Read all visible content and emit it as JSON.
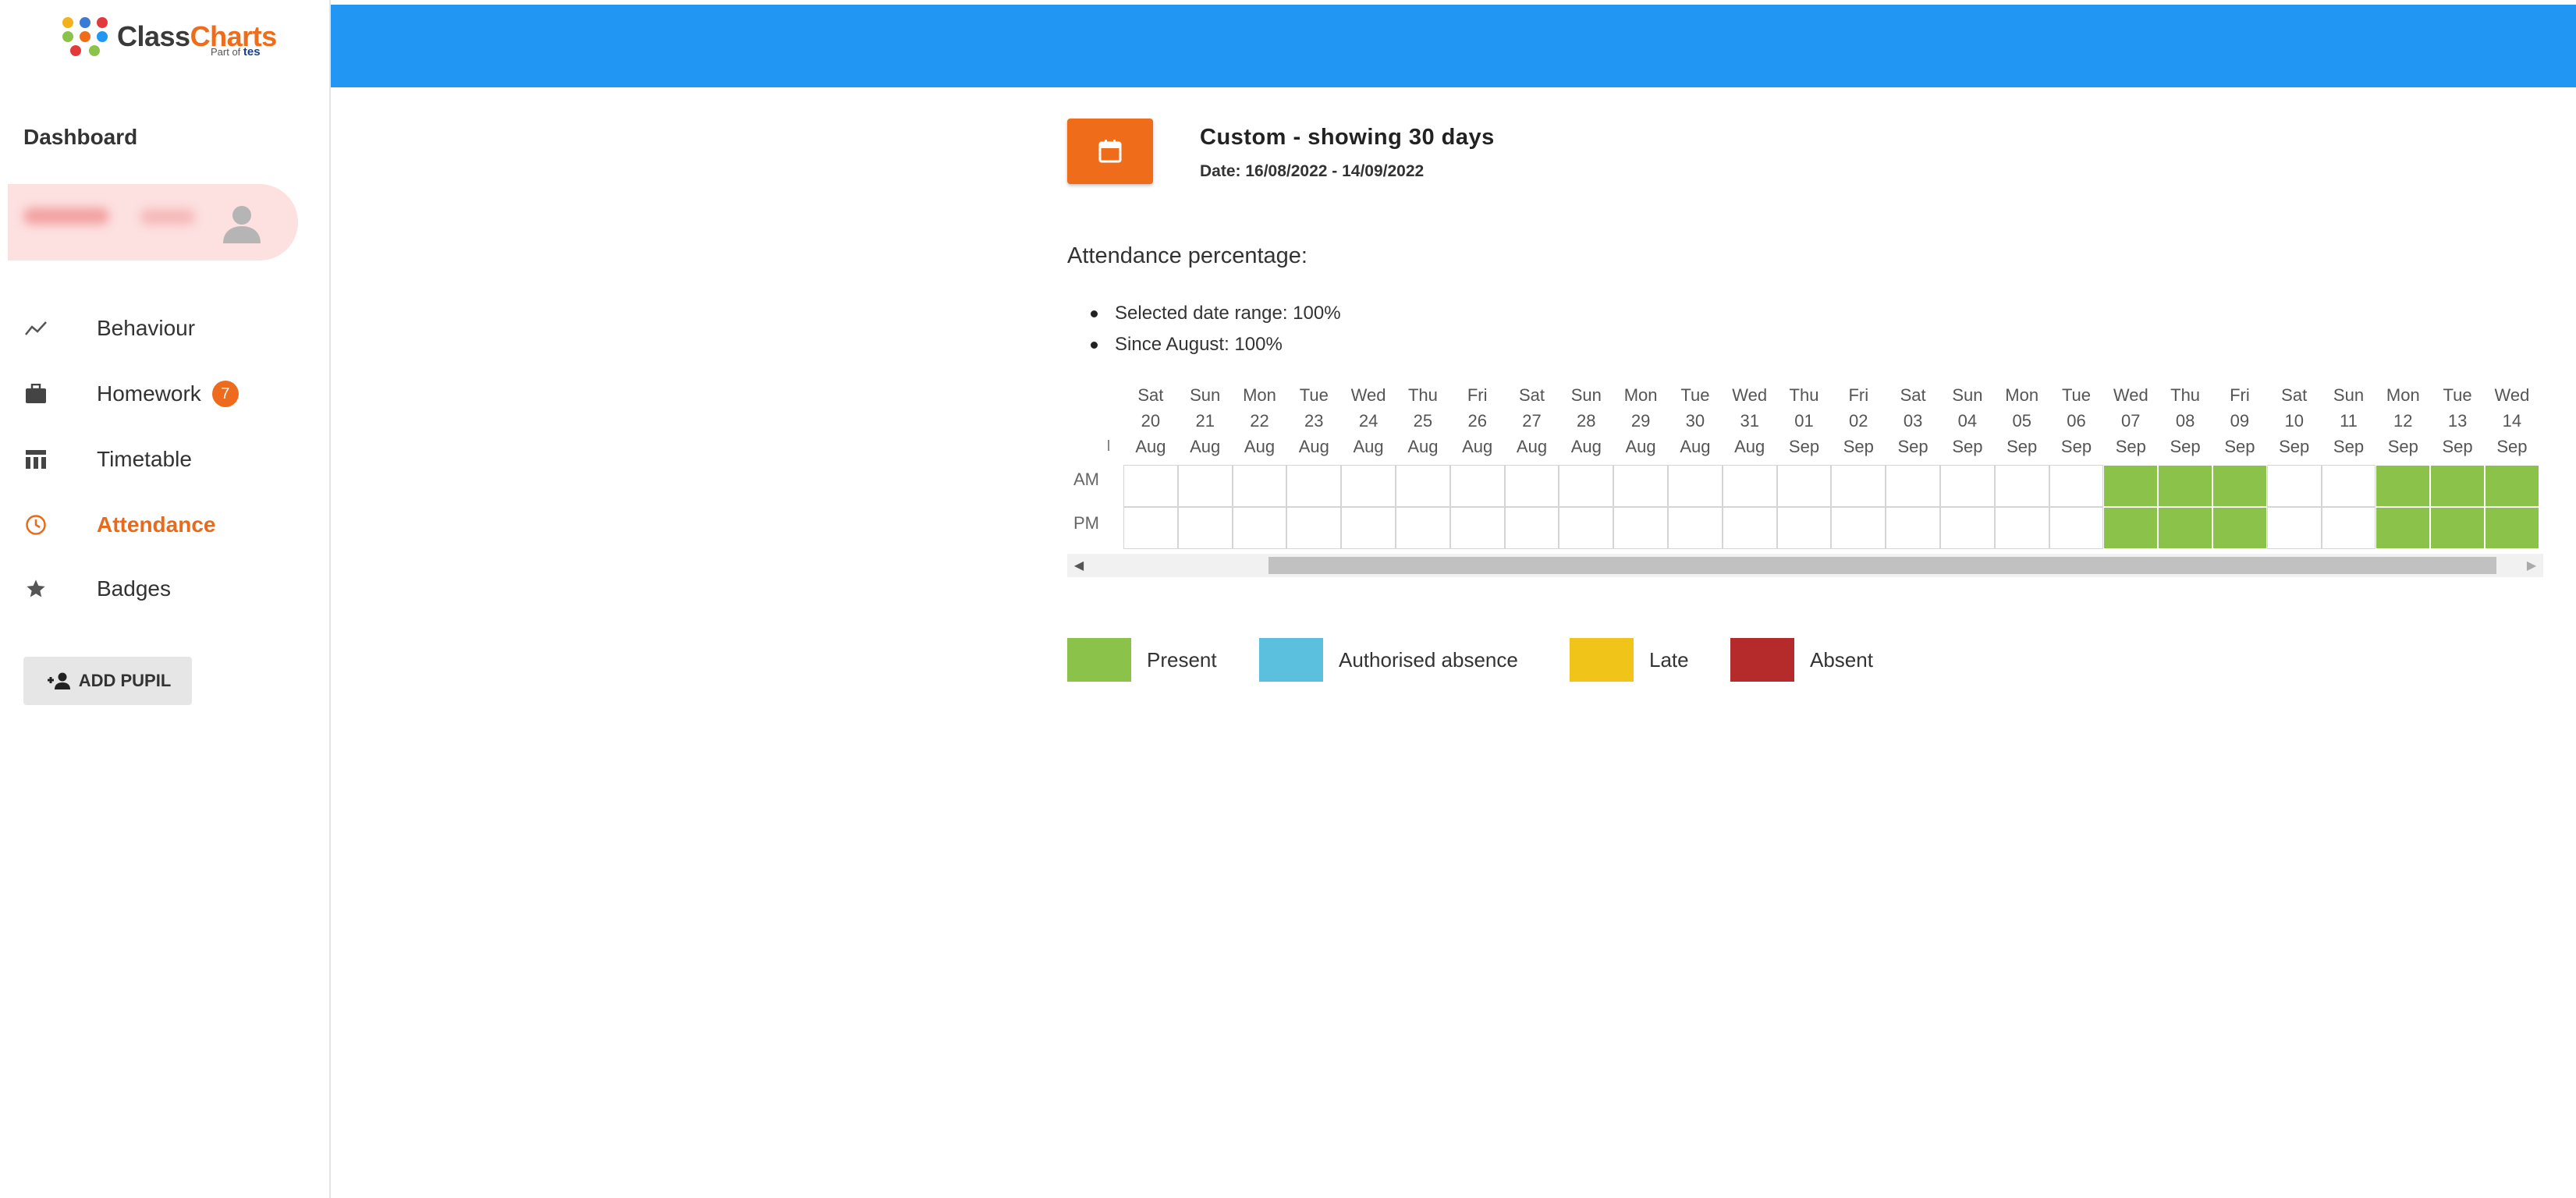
{
  "brand": {
    "part1": "Class",
    "part2": "Charts",
    "sub_prefix": "Part of",
    "sub_brand": "tes"
  },
  "sidebar": {
    "title": "Dashboard",
    "nav": [
      {
        "label": "Behaviour",
        "icon": "trend-line-icon"
      },
      {
        "label": "Homework",
        "icon": "briefcase-icon",
        "count": "7"
      },
      {
        "label": "Timetable",
        "icon": "timetable-icon"
      },
      {
        "label": "Attendance",
        "icon": "clock-icon",
        "active": true
      },
      {
        "label": "Badges",
        "icon": "star-icon"
      }
    ],
    "add_pupil": "ADD PUPIL"
  },
  "colors": {
    "topbar": "#2196f3",
    "accent": "#ef6c1a",
    "present": "#8bc34a",
    "authorised": "#5bc0de",
    "late": "#f0c419",
    "absent": "#b52a2a"
  },
  "range": {
    "title": "Custom - showing 30 days",
    "date": "Date: 16/08/2022 - 14/09/2022"
  },
  "attendance": {
    "heading": "Attendance percentage:",
    "stats": [
      "Selected date range: 100%",
      "Since August: 100%"
    ]
  },
  "grid": {
    "rows": [
      "AM",
      "PM"
    ],
    "days": [
      {
        "dow": "Sat",
        "day": "20",
        "mon": "Aug",
        "present": false
      },
      {
        "dow": "Sun",
        "day": "21",
        "mon": "Aug",
        "present": false
      },
      {
        "dow": "Mon",
        "day": "22",
        "mon": "Aug",
        "present": false
      },
      {
        "dow": "Tue",
        "day": "23",
        "mon": "Aug",
        "present": false
      },
      {
        "dow": "Wed",
        "day": "24",
        "mon": "Aug",
        "present": false
      },
      {
        "dow": "Thu",
        "day": "25",
        "mon": "Aug",
        "present": false
      },
      {
        "dow": "Fri",
        "day": "26",
        "mon": "Aug",
        "present": false
      },
      {
        "dow": "Sat",
        "day": "27",
        "mon": "Aug",
        "present": false
      },
      {
        "dow": "Sun",
        "day": "28",
        "mon": "Aug",
        "present": false
      },
      {
        "dow": "Mon",
        "day": "29",
        "mon": "Aug",
        "present": false
      },
      {
        "dow": "Tue",
        "day": "30",
        "mon": "Aug",
        "present": false
      },
      {
        "dow": "Wed",
        "day": "31",
        "mon": "Aug",
        "present": false
      },
      {
        "dow": "Thu",
        "day": "01",
        "mon": "Sep",
        "present": false
      },
      {
        "dow": "Fri",
        "day": "02",
        "mon": "Sep",
        "present": false
      },
      {
        "dow": "Sat",
        "day": "03",
        "mon": "Sep",
        "present": false
      },
      {
        "dow": "Sun",
        "day": "04",
        "mon": "Sep",
        "present": false
      },
      {
        "dow": "Mon",
        "day": "05",
        "mon": "Sep",
        "present": false
      },
      {
        "dow": "Tue",
        "day": "06",
        "mon": "Sep",
        "present": false
      },
      {
        "dow": "Wed",
        "day": "07",
        "mon": "Sep",
        "present": true
      },
      {
        "dow": "Thu",
        "day": "08",
        "mon": "Sep",
        "present": true
      },
      {
        "dow": "Fri",
        "day": "09",
        "mon": "Sep",
        "present": true
      },
      {
        "dow": "Sat",
        "day": "10",
        "mon": "Sep",
        "present": false
      },
      {
        "dow": "Sun",
        "day": "11",
        "mon": "Sep",
        "present": false
      },
      {
        "dow": "Mon",
        "day": "12",
        "mon": "Sep",
        "present": true
      },
      {
        "dow": "Tue",
        "day": "13",
        "mon": "Sep",
        "present": true
      },
      {
        "dow": "Wed",
        "day": "14",
        "mon": "Sep",
        "present": true
      }
    ]
  },
  "legend": [
    {
      "label": "Present",
      "color": "#8bc34a"
    },
    {
      "label": "Authorised absence",
      "color": "#5bc0de"
    },
    {
      "label": "Late",
      "color": "#f0c419"
    },
    {
      "label": "Absent",
      "color": "#b52a2a"
    }
  ]
}
